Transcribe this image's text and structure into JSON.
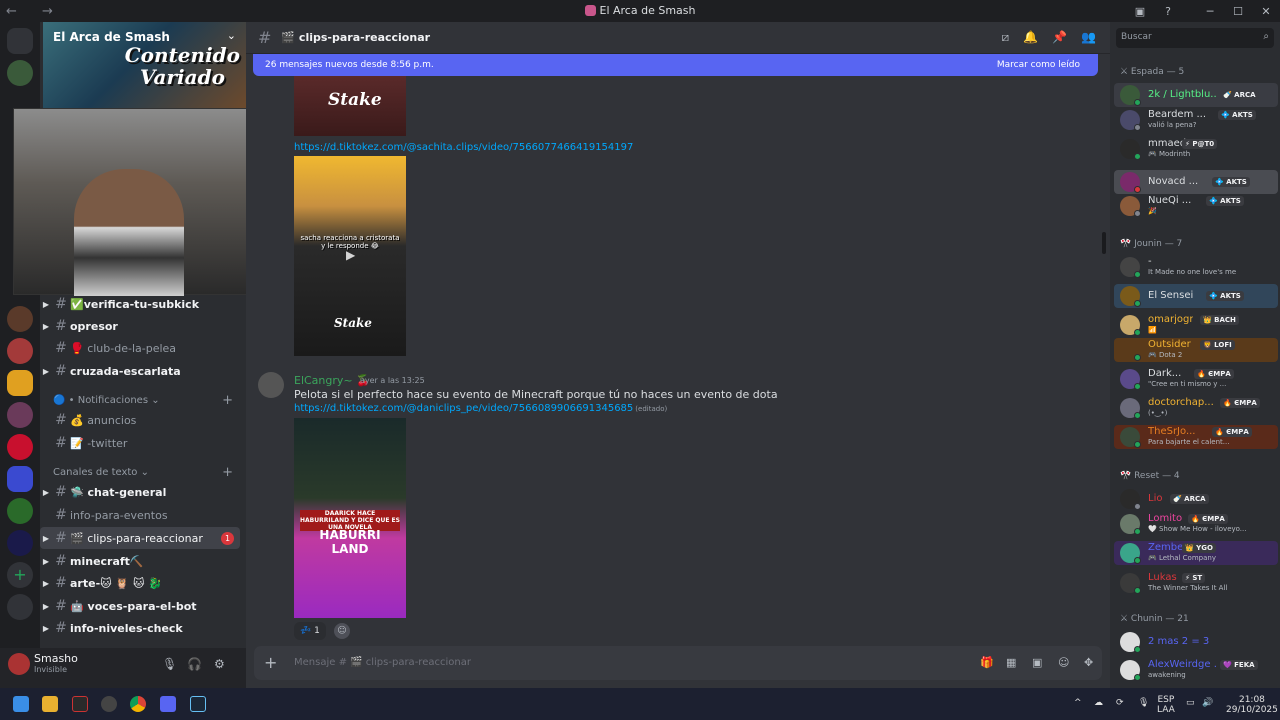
{
  "window": {
    "title": "El Arca de Smash",
    "nav_back": "←",
    "nav_fwd": "→",
    "min": "─",
    "max": "☐",
    "close": "✕",
    "inbox_icon": "▣",
    "help_icon": "?"
  },
  "server": {
    "name": "El Arca de Smash",
    "banner_logo_line1": "Contenido",
    "banner_logo_line2": "Variado"
  },
  "channels": [
    {
      "name": "✅verifica-tu-subkick",
      "bold": true,
      "arrow": true
    },
    {
      "name": "opresor",
      "bold": true,
      "arrow": true
    },
    {
      "name": "🥊 club-de-la-pelea",
      "bold": false,
      "arrow": false
    },
    {
      "name": "cruzada-escarlata",
      "bold": true,
      "arrow": true
    }
  ],
  "categories": {
    "notifications": "🔵 • Notificaciones ⌄",
    "text": "Canales de texto ⌄"
  },
  "notif_channels": [
    {
      "name": "💰 anuncios"
    },
    {
      "name": "📝 -twitter"
    }
  ],
  "text_channels": [
    {
      "name": "🛸 chat-general",
      "bold": true,
      "arrow": true
    },
    {
      "name": "info-para-eventos",
      "bold": false,
      "arrow": false
    },
    {
      "name": "🎬 clips-para-reaccionar",
      "bold": false,
      "arrow": true,
      "active": true,
      "badge": "1"
    },
    {
      "name": "minecraft⛏️",
      "bold": true,
      "arrow": true
    },
    {
      "name": "arte-🐱 🦉 🐱 🐉",
      "bold": true,
      "arrow": true
    },
    {
      "name": "🤖 voces-para-el-bot",
      "bold": true,
      "arrow": true
    },
    {
      "name": "info-niveles-check",
      "bold": true,
      "arrow": true
    }
  ],
  "user": {
    "name": "Smasho",
    "status": "Invisible",
    "mic": "🎙",
    "headset": "🎧",
    "settings": "⚙"
  },
  "header": {
    "channel": "🎬 clips-para-reaccionar",
    "hash": "#"
  },
  "new_bar": {
    "text": "26 mensajes nuevos desde 8:56 p.m.",
    "action": "Marcar como leído"
  },
  "messages": {
    "link1": "https://d.tiktokez.com/@sachita.clips/video/7566077466419154197",
    "thumb1_caption": "sacha reacciona a cristorata y le responde 😂",
    "thumb1_brand": "Stake",
    "thumb0_brand": "Stake",
    "author": "ElCangry~",
    "author_badge": "🍒",
    "timestamp": "ayer a las 13:25",
    "text": "Pelota si el perfecto hace su evento de Minecraft porque tú no haces un evento de dota",
    "link2": "https://d.tiktokez.com/@daniclips_pe/video/7566089906691345685",
    "edited": "(editado)",
    "thumb2_caption": "DAARICK HACE HABURRILAND Y DICE QUE ES UNA NOVELA",
    "thumb2_title": "HABURRI LAND",
    "reaction_emoji": "💤",
    "reaction_count": "1",
    "add_reaction": "☺"
  },
  "composer": {
    "placeholder": "Mensaje # 🎬 clips-para-reaccionar",
    "plus": "+"
  },
  "search": {
    "placeholder": "Buscar",
    "icon": "⌕"
  },
  "member_groups": [
    {
      "label": "⚔ Espada — 5"
    },
    {
      "label": "🎌 Jounin — 7"
    },
    {
      "label": "🎌 Reset — 4"
    },
    {
      "label": "⚔ Chunin — 21"
    }
  ],
  "members": [
    {
      "name": "2k / Lightblu...",
      "tag": "🍼 ARCA",
      "sub": "",
      "color": "#57f287",
      "avatar": "#3a5a3a",
      "status": "#23a55a",
      "bg": "#3a3c43"
    },
    {
      "name": "Beardem ...",
      "tag": "💠 AKTS",
      "sub": "valió la pena?",
      "color": "#dbdee1",
      "avatar": "#4a4a6a",
      "status": "#80848e",
      "bg": ""
    },
    {
      "name": "mmaed",
      "tag": "⚡ P@T0",
      "sub": "🎮 Modrinth",
      "color": "#dbdee1",
      "avatar": "#2a2a2a",
      "status": "#23a55a",
      "bg": ""
    },
    {
      "name": "Novacd ...",
      "tag": "💠 AKTS",
      "sub": "",
      "color": "#dbdee1",
      "avatar": "#7a2a6a",
      "status": "#da373c",
      "bg": "#4a4c52"
    },
    {
      "name": "NueQi ...",
      "tag": "💠 AKTS",
      "sub": "🎉",
      "color": "#dbdee1",
      "avatar": "#8a5a3a",
      "status": "#80848e",
      "bg": ""
    },
    {
      "name": "-",
      "tag": "",
      "sub": "It Made no one love's me",
      "color": "#dbdee1",
      "avatar": "#444",
      "status": "#23a55a",
      "bg": ""
    },
    {
      "name": "El Sensei",
      "tag": "💠 AKTS",
      "sub": "",
      "color": "#dbdee1",
      "avatar": "#7a5a1a",
      "status": "#23a55a",
      "bg": "#31465a"
    },
    {
      "name": "omarjogr",
      "tag": "👑 BACH",
      "sub": "📶",
      "color": "#f0b232",
      "avatar": "#c8a86a",
      "status": "#23a55a",
      "bg": ""
    },
    {
      "name": "Outsider",
      "tag": "🦁 LOFI",
      "sub": "🎮 Dota 2",
      "color": "#f0b232",
      "avatar": "#5a3a1a",
      "status": "#23a55a",
      "bg": "#5a3a1a"
    },
    {
      "name": "Dark...",
      "tag": "🔥 ЄΜΡΑ",
      "sub": "\"Cree en ti mismo y ...",
      "color": "#dbdee1",
      "avatar": "#5a4a8a",
      "status": "#23a55a",
      "bg": ""
    },
    {
      "name": "doctorchap...",
      "tag": "🔥 ЄΜΡΑ",
      "sub": "(•‿•)",
      "color": "#f0b232",
      "avatar": "#6a6a7a",
      "status": "#23a55a",
      "bg": ""
    },
    {
      "name": "TheSrJo...",
      "tag": "🔥 ЄΜΡΑ",
      "sub": "Para bajarte el calent...",
      "color": "#e67e22",
      "avatar": "#3a4a3a",
      "status": "#23a55a",
      "bg": "#5a2a1a"
    },
    {
      "name": "Lio",
      "tag": "🍼 ARCA",
      "sub": "",
      "color": "#da373c",
      "avatar": "#2a2a2a",
      "status": "#80848e",
      "bg": ""
    },
    {
      "name": "Lomito",
      "tag": "🔥 ЄΜΡΑ",
      "sub": "🤍 Show Me How - iloveyo...",
      "color": "#eb459e",
      "avatar": "#6a7a6a",
      "status": "#23a55a",
      "bg": ""
    },
    {
      "name": "Zembe",
      "tag": "👑 YGO",
      "sub": "🎮 Lethal Company",
      "color": "#5865f2",
      "avatar": "#3aa58a",
      "status": "#23a55a",
      "bg": "#3a2a5a"
    },
    {
      "name": "Lukas",
      "tag": "⚡ ST",
      "sub": "The Winner Takes It All",
      "color": "#da373c",
      "avatar": "#3a3a3a",
      "status": "#23a55a",
      "bg": ""
    },
    {
      "name": "2 mas 2 = 3",
      "tag": "",
      "sub": "",
      "color": "#5865f2",
      "avatar": "#ddd",
      "status": "#23a55a",
      "bg": ""
    },
    {
      "name": "AlexWeirdge ...",
      "tag": "💜 FEKA",
      "sub": "awakening",
      "color": "#5865f2",
      "avatar": "#ddd",
      "status": "#23a55a",
      "bg": ""
    }
  ],
  "taskbar": {
    "lang1": "ESP",
    "lang2": "LAA",
    "time": "21:08",
    "date": "29/10/2025"
  }
}
